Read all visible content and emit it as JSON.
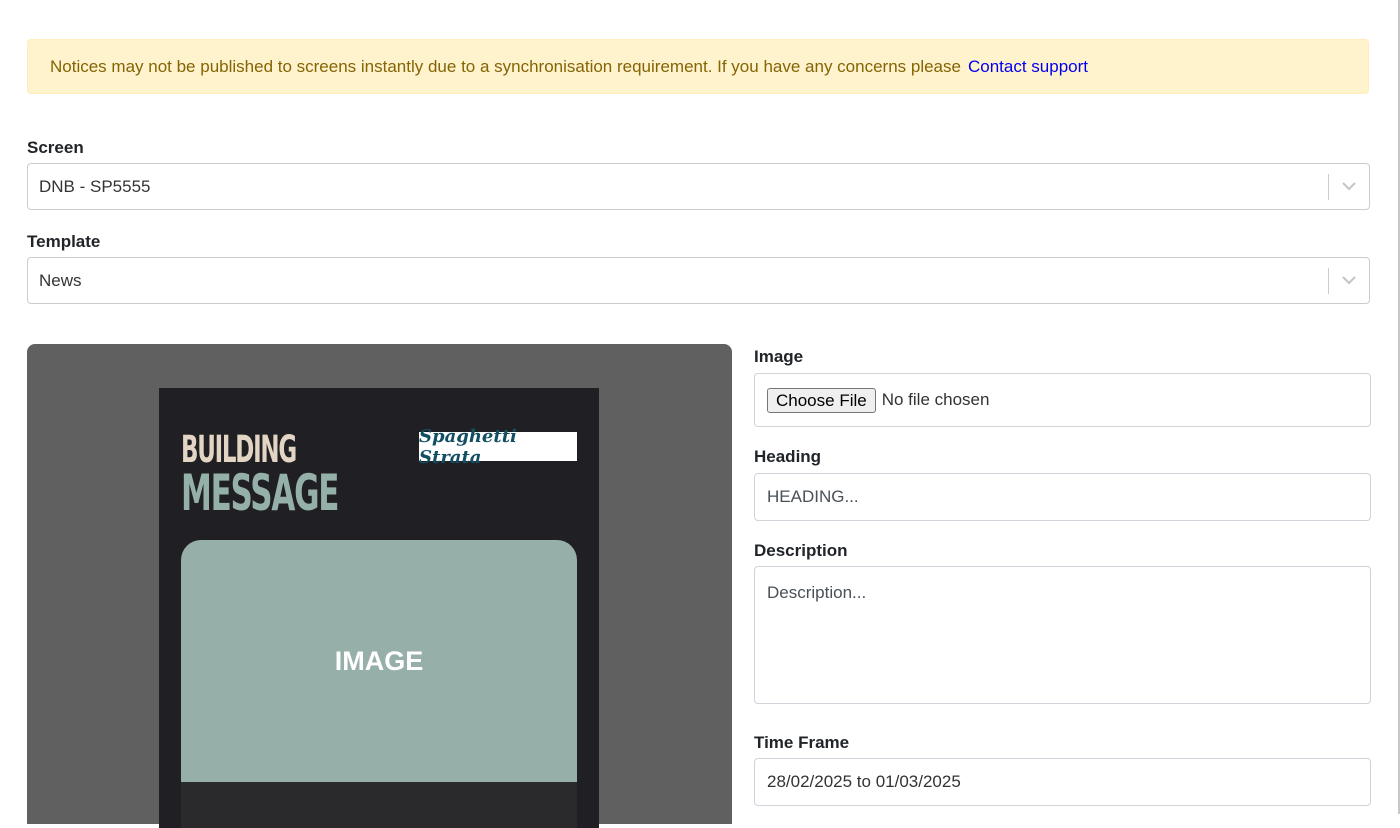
{
  "notice": {
    "text": "Notices may not be published to screens instantly due to a synchronisation requirement. If you have any concerns please",
    "link": "Contact support"
  },
  "screen": {
    "label": "Screen",
    "value": "DNB - SP5555"
  },
  "template": {
    "label": "Template",
    "value": "News"
  },
  "preview": {
    "title_line1": "BUILDING",
    "title_line2": "MESSAGE",
    "logo": "Spaghetti Strata",
    "image_placeholder": "IMAGE"
  },
  "form": {
    "image": {
      "label": "Image",
      "button": "Choose File",
      "status": "No file chosen"
    },
    "heading": {
      "label": "Heading",
      "placeholder": "HEADING..."
    },
    "description": {
      "label": "Description",
      "placeholder": "Description..."
    },
    "time_frame": {
      "label": "Time Frame",
      "value": "28/02/2025 to 01/03/2025"
    }
  }
}
